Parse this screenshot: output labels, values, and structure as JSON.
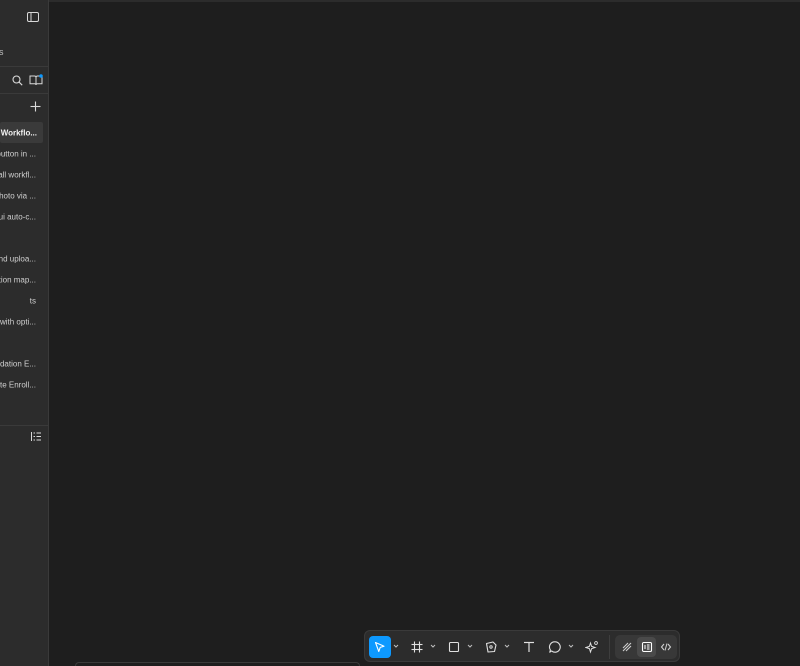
{
  "sidebar": {
    "subtitle": "s",
    "items": [
      {
        "label": "Workflo...",
        "active": true
      },
      {
        "label": "button in ..."
      },
      {
        "label": "all workfl..."
      },
      {
        "label": "photo via ..."
      },
      {
        "label": "ui auto-c..."
      },
      {
        "label": ""
      },
      {
        "label": "nd uploa..."
      },
      {
        "label": "tion map..."
      },
      {
        "label": "ts"
      },
      {
        "label": "with opti..."
      },
      {
        "label": ""
      },
      {
        "label": "lidation E..."
      },
      {
        "label": "te Enroll..."
      }
    ]
  },
  "colors": {
    "accent": "#0d99ff",
    "canvas": "#1e1e1e",
    "panel": "#2c2c2c"
  },
  "icons": {
    "sidebar_toggle": "panel-toggle-icon",
    "search": "search-icon",
    "library": "library-icon",
    "add": "plus-icon",
    "layers": "layers-list-icon",
    "toolbar": [
      "move-cursor-icon",
      "frame-hash-icon",
      "rectangle-icon",
      "pen-icon",
      "text-icon",
      "comment-icon",
      "ai-sparkle-icon",
      "draw-mode-icon",
      "design-mode-icon",
      "dev-mode-icon"
    ]
  }
}
